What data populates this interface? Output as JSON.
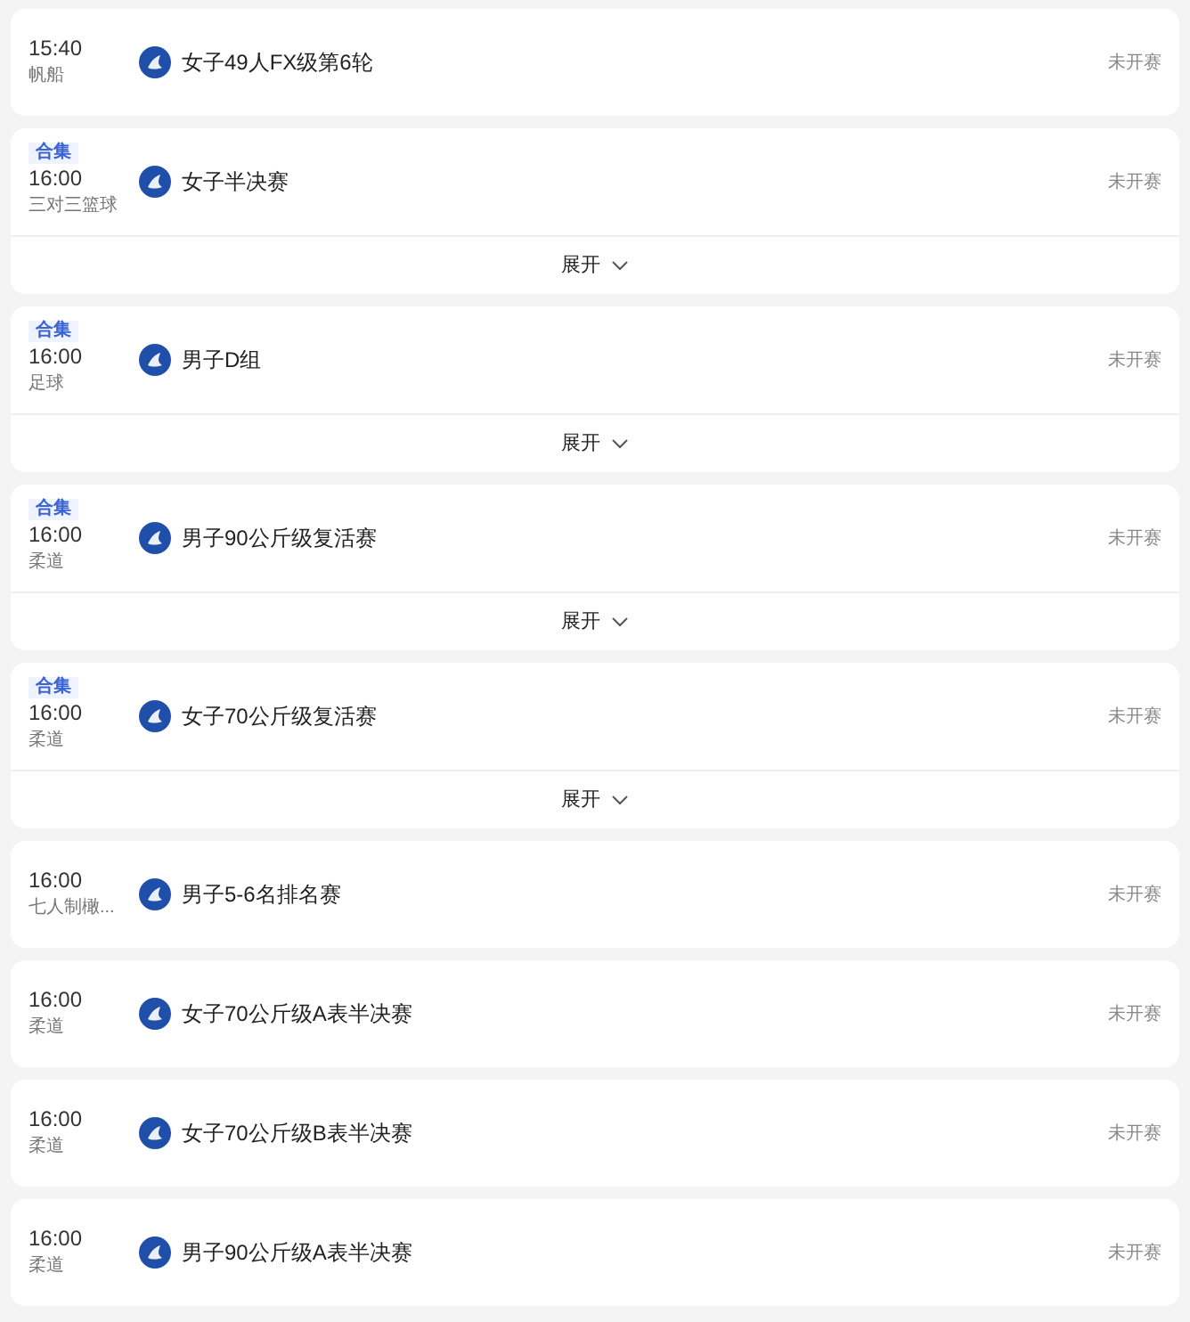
{
  "events": [
    {
      "time": "15:40",
      "sport": "帆船",
      "title": "女子49人FX级第6轮",
      "status": "未开赛"
    },
    {
      "tag": "合集",
      "time": "16:00",
      "sport": "三对三篮球",
      "title": "女子半决赛",
      "status": "未开赛",
      "expand": "展开"
    },
    {
      "tag": "合集",
      "time": "16:00",
      "sport": "足球",
      "title": "男子D组",
      "status": "未开赛",
      "expand": "展开"
    },
    {
      "tag": "合集",
      "time": "16:00",
      "sport": "柔道",
      "title": "男子90公斤级复活赛",
      "status": "未开赛",
      "expand": "展开"
    },
    {
      "tag": "合集",
      "time": "16:00",
      "sport": "柔道",
      "title": "女子70公斤级复活赛",
      "status": "未开赛",
      "expand": "展开"
    },
    {
      "time": "16:00",
      "sport": "七人制橄...",
      "title": "男子5-6名排名赛",
      "status": "未开赛"
    },
    {
      "time": "16:00",
      "sport": "柔道",
      "title": "女子70公斤级A表半决赛",
      "status": "未开赛"
    },
    {
      "time": "16:00",
      "sport": "柔道",
      "title": "女子70公斤级B表半决赛",
      "status": "未开赛"
    },
    {
      "time": "16:00",
      "sport": "柔道",
      "title": "男子90公斤级A表半决赛",
      "status": "未开赛"
    }
  ]
}
